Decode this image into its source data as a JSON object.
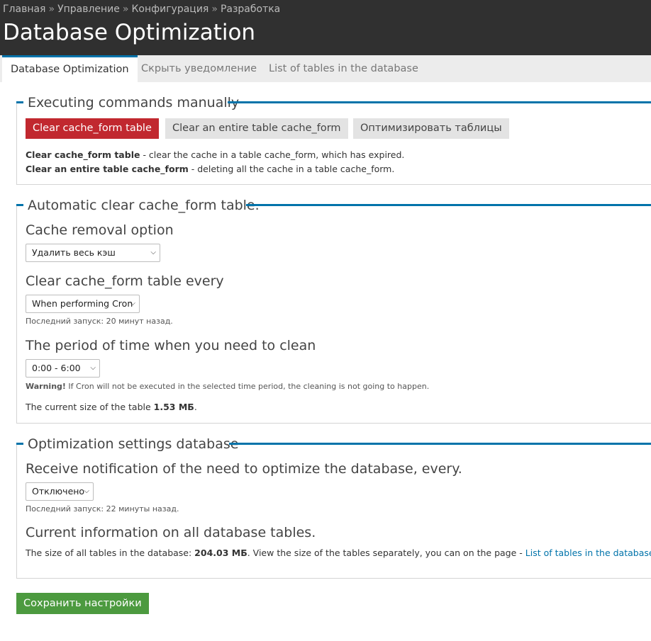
{
  "breadcrumb": {
    "items": [
      "Главная",
      "Управление",
      "Конфигурация",
      "Разработка"
    ],
    "separator": "»"
  },
  "page": {
    "title": "Database Optimization"
  },
  "tabs": [
    {
      "label": "Database Optimization",
      "active": true
    },
    {
      "label": "Скрыть уведомление",
      "active": false
    },
    {
      "label": "List of tables in the database",
      "active": false
    }
  ],
  "section1": {
    "legend": "Executing commands manually",
    "buttons": {
      "clear_expired": "Clear cache_form table",
      "clear_all": "Clear an entire table cache_form",
      "optimize": "Оптимизировать таблицы"
    },
    "desc1_bold": "Clear cache_form table",
    "desc1_text": " - clear the cache in a table cache_form, which has expired.",
    "desc2_bold": "Clear an entire table cache_form",
    "desc2_text": " - deleting all the cache in a table cache_form."
  },
  "section2": {
    "legend": "Automatic clear cache_form table.",
    "removal_label": "Cache removal option",
    "removal_value": "Удалить весь кэш",
    "every_label": "Clear cache_form table every",
    "every_value": "When performing Cron",
    "last_run": "Последний запуск: 20 минут назад.",
    "period_label": "The period of time when you need to clean",
    "period_value": "0:00 - 6:00",
    "warning_bold": "Warning!",
    "warning_text": " If Cron will not be executed in the selected time period, the cleaning is not going to happen.",
    "size_text": "The current size of the table ",
    "size_value": "1.53 МБ",
    "size_end": "."
  },
  "section3": {
    "legend": "Optimization settings database",
    "notify_label": "Receive notification of the need to optimize the database, every.",
    "notify_value": "Отключено",
    "last_run": "Последний запуск: 22 минуты назад.",
    "info_label": "Current information on all database tables.",
    "total_text": "The size of all tables in the database: ",
    "total_value": "204.03 МБ",
    "total_after": ". View the size of the tables separately, you can on the page - ",
    "total_link": "List of tables in the database",
    "total_end": "."
  },
  "save_button": "Сохранить настройки",
  "colors": {
    "header_bg": "#303030",
    "accent": "#0073aa",
    "danger": "#c1282f",
    "success": "#4c9a3f"
  },
  "icons": {
    "select_arrow": "chevron-down-icon"
  }
}
